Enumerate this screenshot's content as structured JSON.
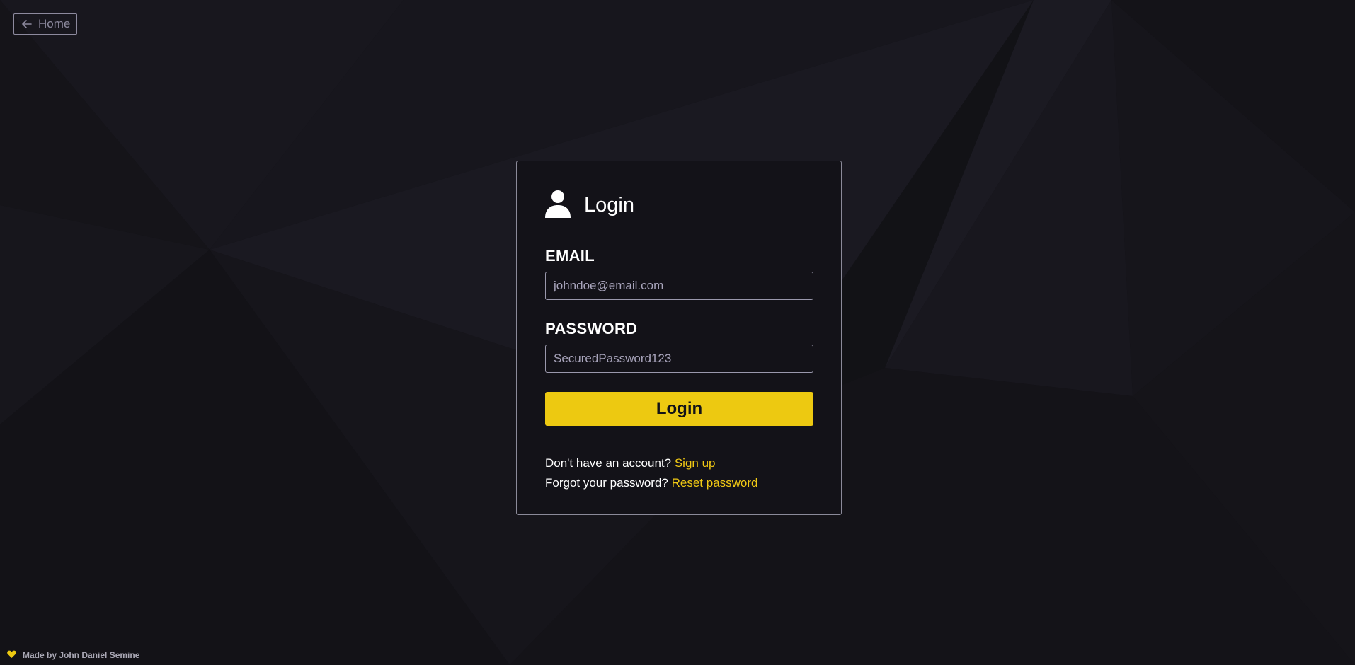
{
  "nav": {
    "home_label": "Home",
    "home_icon": "arrow-left-icon"
  },
  "login_card": {
    "icon": "user-icon",
    "title": "Login",
    "email": {
      "label": "EMAIL",
      "placeholder": "johndoe@email.com",
      "value": ""
    },
    "password": {
      "label": "PASSWORD",
      "placeholder": "SecuredPassword123",
      "value": ""
    },
    "submit_label": "Login",
    "signup_prompt": "Don't have an account?",
    "signup_link": "Sign up",
    "reset_prompt": "Forgot your password?",
    "reset_link": "Reset password"
  },
  "footer": {
    "icon": "heart-icon",
    "credit": "Made by John Daniel Semine"
  },
  "colors": {
    "background": "#121216",
    "accent": "#edc911",
    "border": "#8b8a99",
    "text": "#ffffff"
  }
}
